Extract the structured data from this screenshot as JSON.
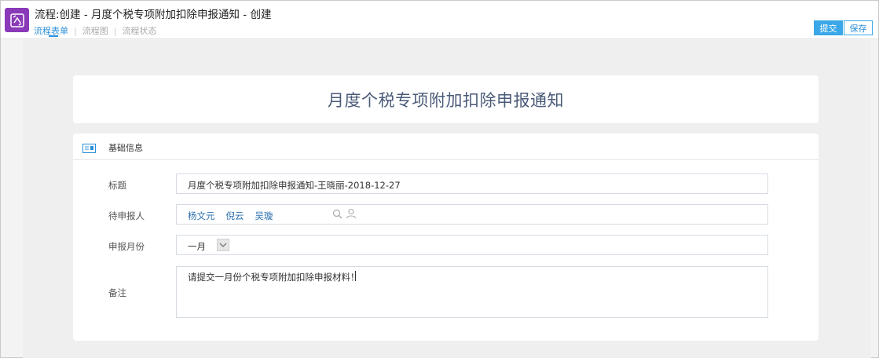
{
  "header": {
    "title": "流程:创建 - 月度个税专项附加扣除申报通知 - 创建",
    "tabs": [
      {
        "label": "流程表单",
        "active": true
      },
      {
        "label": "流程图",
        "active": false
      },
      {
        "label": "流程状态",
        "active": false
      }
    ],
    "tab_separator": "|",
    "submit_label": "提交",
    "save_label": "保存"
  },
  "form": {
    "title": "月度个税专项附加扣除申报通知",
    "section_label": "基础信息",
    "fields": {
      "subject": {
        "label": "标题",
        "value": "月度个税专项附加扣除申报通知-王晓丽-2018-12-27"
      },
      "declarants": {
        "label": "待申报人",
        "people": [
          "杨文元",
          "倪云",
          "吴璇"
        ]
      },
      "month": {
        "label": "申报月份",
        "value": "一月"
      },
      "remark": {
        "label": "备注",
        "value": "请提交一月份个税专项附加扣除申报材料！"
      }
    }
  },
  "icons": {
    "app": "workflow-icon",
    "section": "info-card-icon",
    "search": "search-icon",
    "person_picker": "person-icon",
    "dropdown": "chevron-down-icon"
  },
  "colors": {
    "accent": "#3aa7e8",
    "link": "#2b8fd8",
    "app_icon_bg": "#8a3ab9",
    "title_text": "#4a5a78"
  }
}
